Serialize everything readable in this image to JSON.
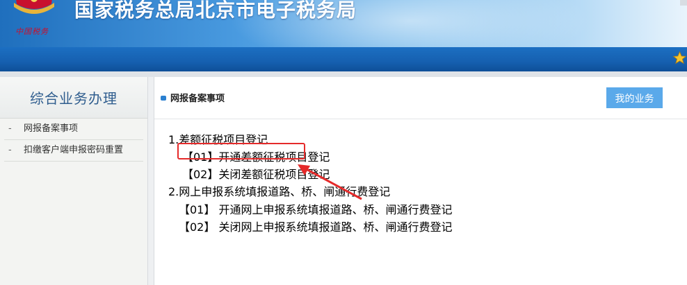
{
  "header": {
    "title": "国家税务总局北京市电子税务局",
    "logo_caption": "中国税务"
  },
  "sidebar": {
    "title": "综合业务办理",
    "items": [
      {
        "dash": "-",
        "label": "网报备案事项"
      },
      {
        "dash": "-",
        "label": "扣缴客户端申报密码重置"
      }
    ]
  },
  "main": {
    "section_title": "网报备案事项",
    "my_business_label": "我的业务",
    "groups": [
      {
        "heading": "1.差额征税项目登记",
        "items": [
          {
            "code": "【01】",
            "label": "开通差额征税项目登记"
          },
          {
            "code": "【02】",
            "label": "关闭差额征税项目登记"
          }
        ]
      },
      {
        "heading": "2.网上申报系统填报道路、桥、闸通行费登记",
        "items": [
          {
            "code": "【01】",
            "label": "开通网上申报系统填报道路、桥、闸通行费登记"
          },
          {
            "code": "【02】",
            "label": "关闭网上申报系统填报道路、桥、闸通行费登记"
          }
        ]
      }
    ]
  },
  "colors": {
    "accent": "#5aa9ea",
    "highlight": "#e52a2a",
    "sidebar_title": "#2f5d8e"
  }
}
